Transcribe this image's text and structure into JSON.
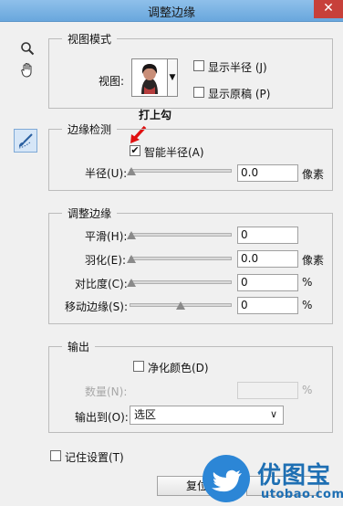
{
  "window": {
    "title": "调整边缘",
    "close_glyph": "✕"
  },
  "tools": [
    "zoom-tool",
    "hand-tool",
    "refine-radius-brush-tool"
  ],
  "view_mode": {
    "group_title": "视图模式",
    "view_label": "视图:",
    "show_radius_label": "显示半径 (J)",
    "show_radius_checked": false,
    "show_original_label": "显示原稿 (P)",
    "show_original_checked": false
  },
  "edge_detection": {
    "group_title": "边缘检测",
    "smart_radius_label": "智能半径(A)",
    "smart_radius_checked": true,
    "radius_label": "半径(U):",
    "radius_value": "0.0",
    "radius_unit": "像素",
    "radius_slider": 0
  },
  "annotation": {
    "text": "打上勾",
    "arrow_color": "#e01010"
  },
  "adjust_edge": {
    "group_title": "调整边缘",
    "rows": [
      {
        "label": "平滑(H):",
        "value": "0",
        "unit": "",
        "slider": 0
      },
      {
        "label": "羽化(E):",
        "value": "0.0",
        "unit": "像素",
        "slider": 0
      },
      {
        "label": "对比度(C):",
        "value": "0",
        "unit": "%",
        "slider": 0
      },
      {
        "label": "移动边缘(S):",
        "value": "0",
        "unit": "%",
        "slider": 0.5
      }
    ]
  },
  "output": {
    "group_title": "输出",
    "decontaminate_label": "净化颜色(D)",
    "decontaminate_checked": false,
    "amount_label": "数量(N):",
    "amount_unit": "%",
    "output_to_label": "输出到(O):",
    "output_to_value": "选区"
  },
  "remember_label": "记住设置(T)",
  "remember_checked": false,
  "reset_button_label": "复位",
  "watermark": {
    "brand_text": "优图宝",
    "url_text": "utobao.com",
    "color": "#1e6fb3"
  }
}
